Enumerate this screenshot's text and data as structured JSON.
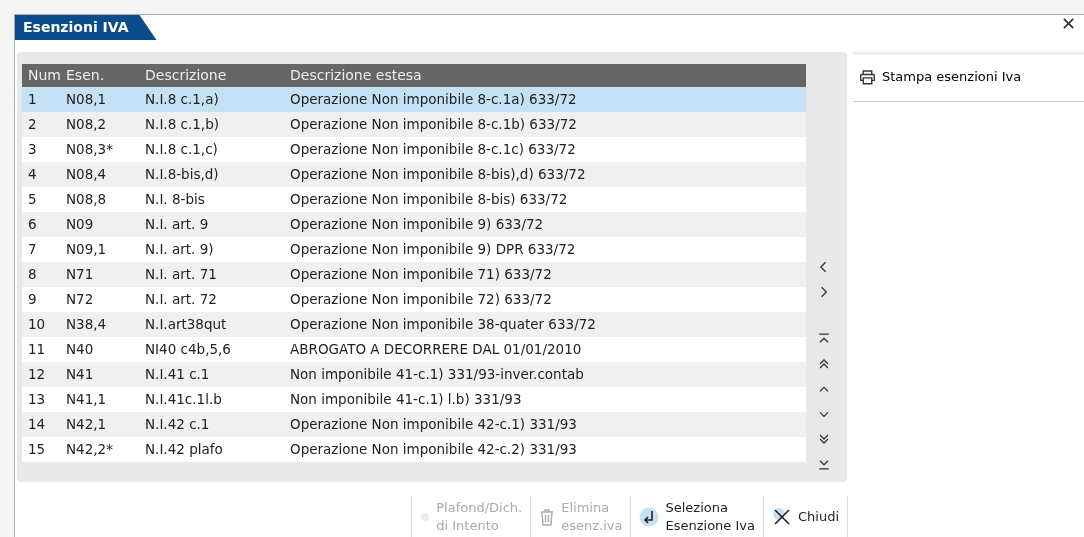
{
  "window": {
    "title": "Esenzioni IVA",
    "close": "✕"
  },
  "table": {
    "columns": [
      "Num",
      "Esen.",
      "Descrizione",
      "Descrizione estesa"
    ],
    "rows": [
      {
        "cells": [
          "1",
          "N08,1",
          "N.I.8 c.1,a)",
          "Operazione Non imponibile 8-c.1a) 633/72"
        ],
        "selected": true
      },
      {
        "cells": [
          "2",
          "N08,2",
          "N.I.8 c.1,b)",
          "Operazione Non imponibile 8-c.1b) 633/72"
        ],
        "selected": false
      },
      {
        "cells": [
          "3",
          "N08,3*",
          "N.I.8 c.1,c)",
          "Operazione Non imponibile 8-c.1c) 633/72"
        ],
        "selected": false
      },
      {
        "cells": [
          "4",
          "N08,4",
          "N.I.8-bis,d)",
          "Operazione Non imponibile 8-bis),d) 633/72"
        ],
        "selected": false
      },
      {
        "cells": [
          "5",
          "N08,8",
          "N.I. 8-bis",
          "Operazione Non imponibile 8-bis) 633/72"
        ],
        "selected": false
      },
      {
        "cells": [
          "6",
          "N09",
          "N.I. art. 9",
          "Operazione Non imponibile 9) 633/72"
        ],
        "selected": false
      },
      {
        "cells": [
          "7",
          "N09,1",
          "N.I. art. 9)",
          "Operazione Non imponibile 9) DPR 633/72"
        ],
        "selected": false
      },
      {
        "cells": [
          "8",
          "N71",
          "N.I. art. 71",
          "Operazione Non imponibile 71) 633/72"
        ],
        "selected": false
      },
      {
        "cells": [
          "9",
          "N72",
          "N.I. art. 72",
          "Operazione Non imponibile 72) 633/72"
        ],
        "selected": false
      },
      {
        "cells": [
          "10",
          "N38,4",
          "N.I.art38qut",
          "Operazione Non imponibile 38-quater 633/72"
        ],
        "selected": false
      },
      {
        "cells": [
          "11",
          "N40",
          "NI40 c4b,5,6",
          "ABROGATO A DECORRERE DAL 01/01/2010"
        ],
        "selected": false
      },
      {
        "cells": [
          "12",
          "N41",
          "N.I.41 c.1",
          "Non imponibile 41-c.1) 331/93-inver.contab"
        ],
        "selected": false
      },
      {
        "cells": [
          "13",
          "N41,1",
          "N.I.41c.1l.b",
          "Non imponibile 41-c.1) l.b) 331/93"
        ],
        "selected": false
      },
      {
        "cells": [
          "14",
          "N42,1",
          "N.I.42 c.1",
          "Operazione Non imponibile 42-c.1) 331/93"
        ],
        "selected": false
      },
      {
        "cells": [
          "15",
          "N42,2*",
          "N.I.42 plafo",
          "Operazione Non imponibile 42-c.2) 331/93"
        ],
        "selected": false
      }
    ]
  },
  "nav": [
    {
      "kind": "left"
    },
    {
      "kind": "right"
    },
    {
      "kind": "gap"
    },
    {
      "kind": "first"
    },
    {
      "kind": "pageup"
    },
    {
      "kind": "up"
    },
    {
      "kind": "down"
    },
    {
      "kind": "pagedown"
    },
    {
      "kind": "last"
    }
  ],
  "side_actions": [
    {
      "label": "Stampa esenzioni Iva"
    }
  ],
  "buttons": [
    {
      "label": "Plafond/Dich.\ndi Intento",
      "kind": "dot",
      "disabled": true
    },
    {
      "label": "Elimina\nesenz.iva",
      "kind": "trash",
      "disabled": true
    },
    {
      "label": "Seleziona\nEsenzione Iva",
      "kind": "enter",
      "disabled": false
    },
    {
      "label": "Chiudi",
      "kind": "close",
      "disabled": false
    }
  ]
}
